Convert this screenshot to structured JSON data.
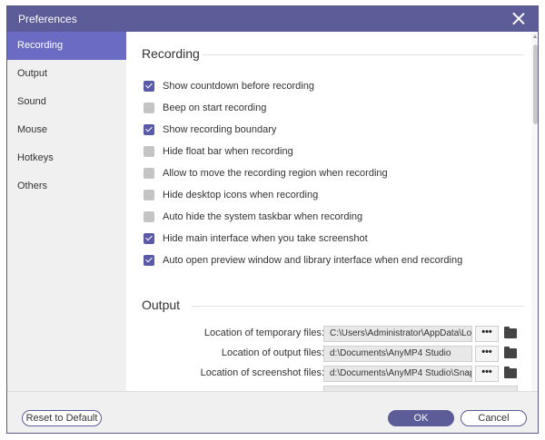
{
  "window": {
    "title": "Preferences"
  },
  "sidebar": {
    "items": [
      {
        "label": "Recording",
        "active": true
      },
      {
        "label": "Output",
        "active": false
      },
      {
        "label": "Sound",
        "active": false
      },
      {
        "label": "Mouse",
        "active": false
      },
      {
        "label": "Hotkeys",
        "active": false
      },
      {
        "label": "Others",
        "active": false
      }
    ]
  },
  "recording": {
    "title": "Recording",
    "options": [
      {
        "label": "Show countdown before recording",
        "checked": true
      },
      {
        "label": "Beep on start recording",
        "checked": false
      },
      {
        "label": "Show recording boundary",
        "checked": true
      },
      {
        "label": "Hide float bar when recording",
        "checked": false
      },
      {
        "label": "Allow to move the recording region when recording",
        "checked": false
      },
      {
        "label": "Hide desktop icons when recording",
        "checked": false
      },
      {
        "label": "Auto hide the system taskbar when recording",
        "checked": false
      },
      {
        "label": "Hide main interface when you take screenshot",
        "checked": true
      },
      {
        "label": "Auto open preview window and library interface when end recording",
        "checked": true
      }
    ]
  },
  "output": {
    "title": "Output",
    "rows": [
      {
        "label": "Location of temporary files:",
        "value": "C:\\Users\\Administrator\\AppData\\Lo"
      },
      {
        "label": "Location of output files:",
        "value": "d:\\Documents\\AnyMP4 Studio"
      },
      {
        "label": "Location of screenshot files:",
        "value": "d:\\Documents\\AnyMP4 Studio\\Snap"
      }
    ],
    "browse_label": "•••"
  },
  "footer": {
    "reset_label": "Reset to Default",
    "ok_label": "OK",
    "cancel_label": "Cancel"
  }
}
